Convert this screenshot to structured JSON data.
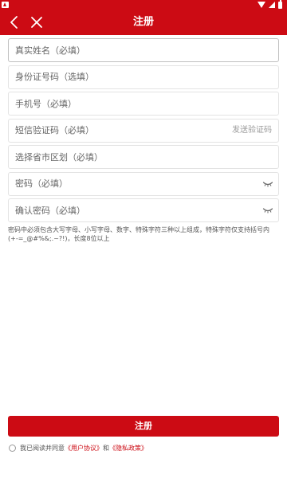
{
  "colors": {
    "accent": "#cc0b14",
    "hint": "#555555",
    "placeholder": "#666666"
  },
  "header": {
    "title": "注册",
    "back_icon": "chevron-left-icon",
    "close_icon": "close-icon"
  },
  "form": {
    "fields": [
      {
        "placeholder": "真实姓名（必填）",
        "value": ""
      },
      {
        "placeholder": "身份证号码（选填）",
        "value": ""
      },
      {
        "placeholder": "手机号（必填）",
        "value": ""
      },
      {
        "placeholder": "短信验证码（必填）",
        "value": "",
        "action": "发送验证码"
      },
      {
        "placeholder": "选择省市区划（必填）",
        "value": ""
      },
      {
        "placeholder": "密码（必填）",
        "value": "",
        "icon": "eye-closed-icon"
      },
      {
        "placeholder": "确认密码（必填）",
        "value": "",
        "icon": "eye-closed-icon"
      }
    ],
    "password_hint": "密码中必须包含大写字母、小写字母、数字、特殊字符三种以上组成，特殊字符仅支持括号内(+-=_@#%&;.~?!)，长度8位以上"
  },
  "submit_label": "注册",
  "agreement": {
    "prefix": "我已阅读并同意",
    "user_agreement": "《用户协议》",
    "conjunction": "和",
    "privacy_policy": "《隐私政策》"
  }
}
